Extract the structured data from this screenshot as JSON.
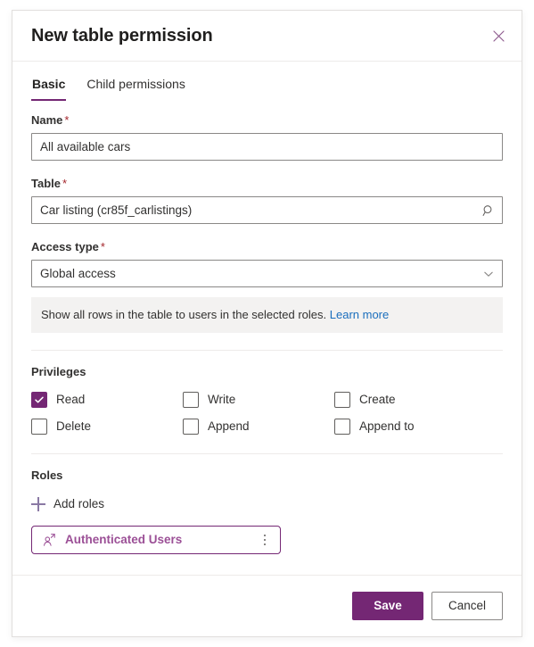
{
  "dialog": {
    "title": "New table permission",
    "close_icon": "close-icon"
  },
  "tabs": [
    {
      "label": "Basic",
      "active": true
    },
    {
      "label": "Child permissions",
      "active": false
    }
  ],
  "form": {
    "name": {
      "label": "Name",
      "required_marker": "*",
      "value": "All available cars",
      "placeholder": ""
    },
    "table": {
      "label": "Table",
      "required_marker": "*",
      "value": "Car listing (cr85f_carlistings)",
      "placeholder": "",
      "icon": "search-icon"
    },
    "access_type": {
      "label": "Access type",
      "required_marker": "*",
      "value": "Global access",
      "chevron_icon": "chevron-down-icon",
      "options": [
        "Global access"
      ]
    },
    "info_banner": {
      "text": "Show all rows in the table to users in the selected roles.",
      "link_label": "Learn more",
      "link_color": "#1a6ebd",
      "background": "#f3f2f1"
    }
  },
  "privileges": {
    "title": "Privileges",
    "items": [
      {
        "label": "Read",
        "checked": true
      },
      {
        "label": "Write",
        "checked": false
      },
      {
        "label": "Create",
        "checked": false
      },
      {
        "label": "Delete",
        "checked": false
      },
      {
        "label": "Append",
        "checked": false
      },
      {
        "label": "Append to",
        "checked": false
      }
    ]
  },
  "roles": {
    "title": "Roles",
    "add_label": "Add roles",
    "add_icon": "plus-icon",
    "items": [
      {
        "label": "Authenticated Users",
        "icon": "person-role-icon",
        "more_icon": "more-vertical-icon"
      }
    ]
  },
  "footer": {
    "save_label": "Save",
    "cancel_label": "Cancel"
  },
  "theme": {
    "accent": "#742774",
    "accent_text": "#9b4f96",
    "link": "#1a6ebd",
    "required": "#a4262c",
    "border": "#8a8886",
    "divider": "#edebe9"
  }
}
